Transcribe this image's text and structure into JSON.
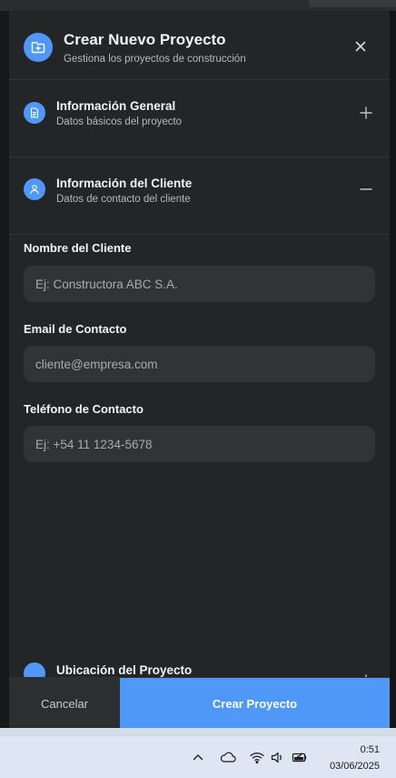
{
  "header": {
    "title": "Crear Nuevo Proyecto",
    "subtitle": "Gestiona los proyectos de construcción",
    "icon": "folder-plus-icon",
    "close_icon": "close-icon"
  },
  "sections": [
    {
      "title": "Información General",
      "subtitle": "Datos básicos del proyecto",
      "icon": "document-icon",
      "state": "collapsed"
    },
    {
      "title": "Información del Cliente",
      "subtitle": "Datos de contacto del cliente",
      "icon": "user-icon",
      "state": "expanded"
    },
    {
      "title": "Ubicación del Proyecto",
      "subtitle": "",
      "icon": "location-icon",
      "state": "collapsed"
    }
  ],
  "client_fields": {
    "name": {
      "label": "Nombre del Cliente",
      "placeholder": "Ej: Constructora ABC S.A.",
      "value": ""
    },
    "email": {
      "label": "Email de Contacto",
      "placeholder": "cliente@empresa.com",
      "value": ""
    },
    "phone": {
      "label": "Teléfono de Contacto",
      "placeholder": "Ej: +54 11 1234-5678",
      "value": ""
    }
  },
  "footer": {
    "cancel_label": "Cancelar",
    "create_label": "Crear Proyecto"
  },
  "taskbar": {
    "time": "0:51",
    "date": "03/06/2025"
  },
  "colors": {
    "accent": "#4f98f7",
    "panel_bg": "#242526",
    "input_bg": "#323334"
  }
}
